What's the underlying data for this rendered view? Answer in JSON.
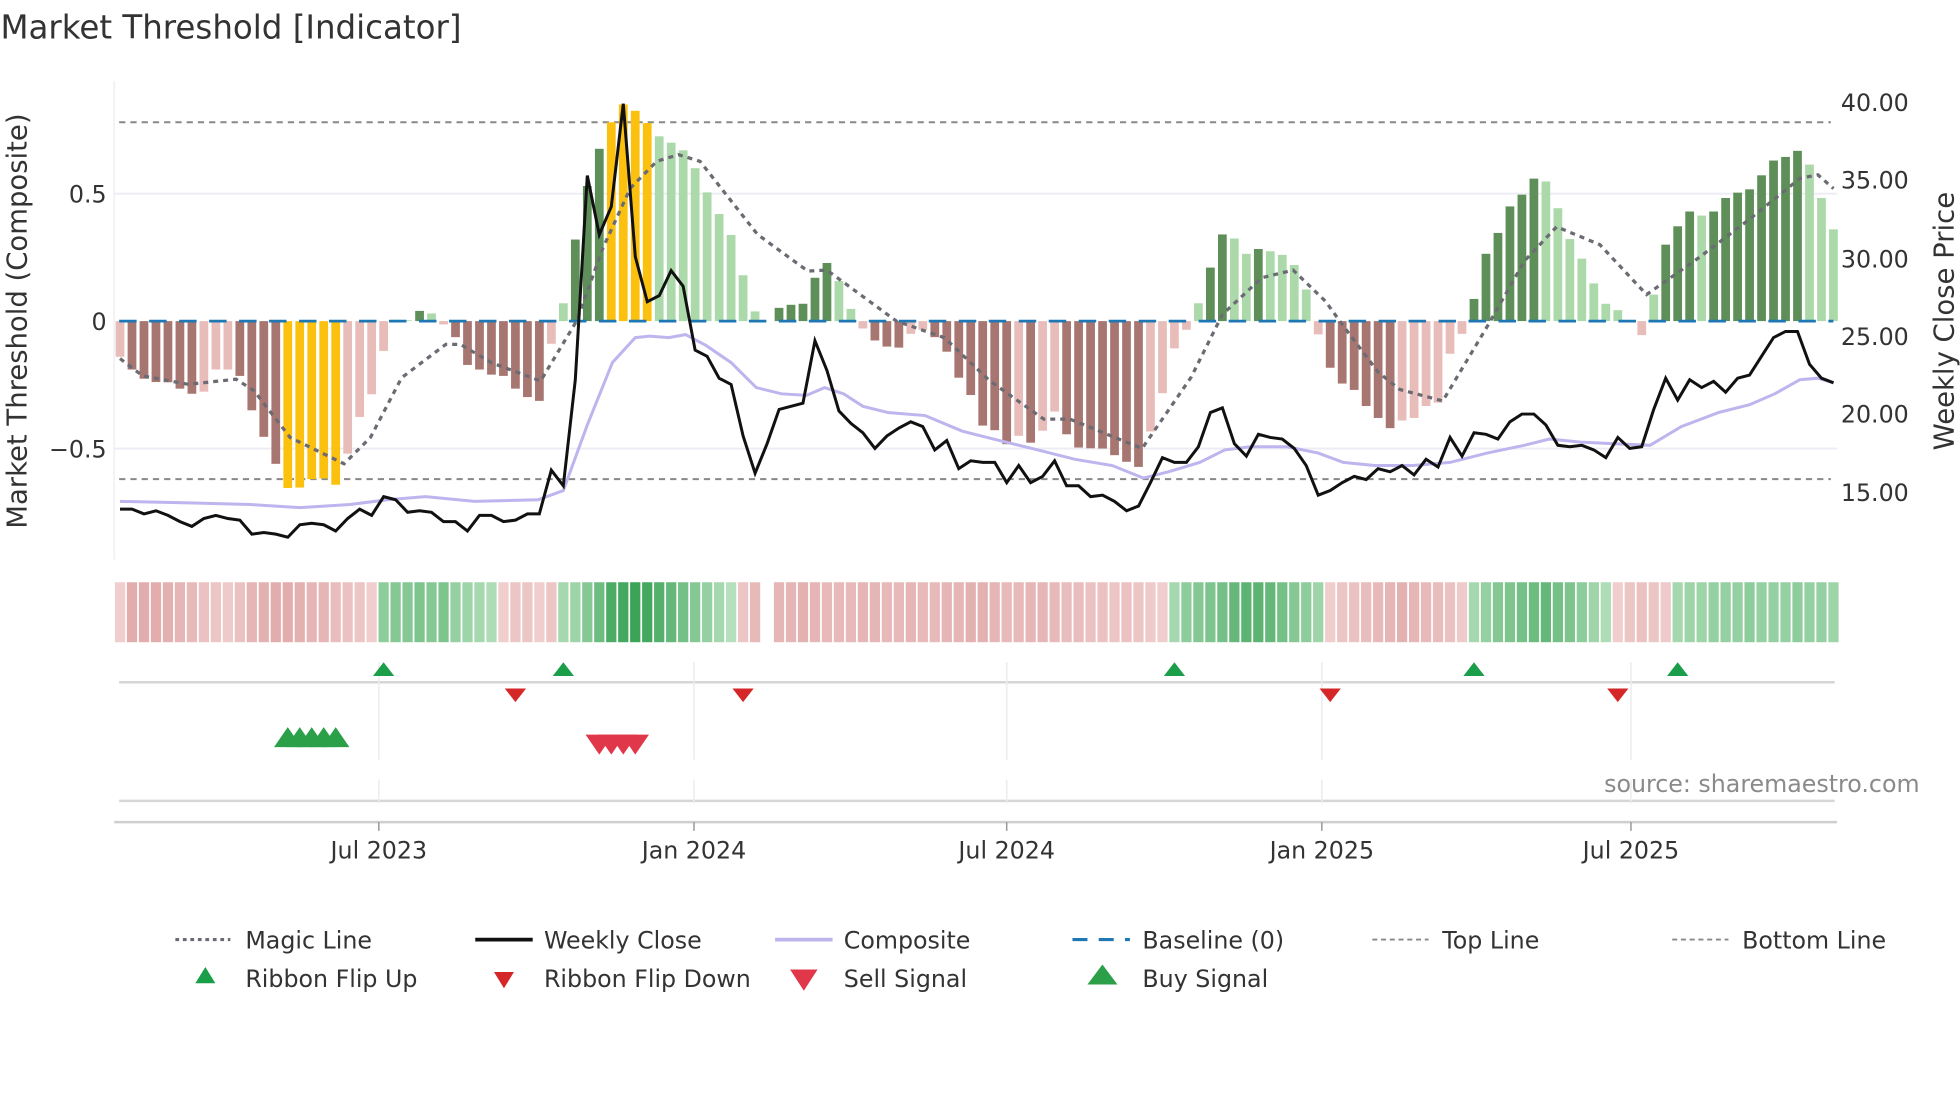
{
  "chart_data": {
    "type": "bar",
    "title": "Market Threshold [Indicator]",
    "ylabel_left": "Market Threshold (Composite)",
    "ylabel_right": "Weekly Close Price",
    "ylim_left": [
      -0.94,
      0.94
    ],
    "ylim_right": [
      10.7,
      41.4
    ],
    "grid": true,
    "legend_placement": "bottom",
    "source": "source: sharemaestro.com",
    "y_ticks_left": [
      {
        "value": 0.5,
        "label": "0.5"
      },
      {
        "value": 0,
        "label": "0"
      },
      {
        "value": -0.5,
        "label": "−0.5"
      }
    ],
    "y_ticks_right": [
      {
        "value": 40,
        "label": "40.00"
      },
      {
        "value": 35,
        "label": "35.00"
      },
      {
        "value": 30,
        "label": "30.00"
      },
      {
        "value": 25,
        "label": "25.00"
      },
      {
        "value": 20,
        "label": "20.00"
      },
      {
        "value": 15,
        "label": "15.00"
      }
    ],
    "x_ticks": [
      {
        "week": 21.6,
        "label": "Jul 2023"
      },
      {
        "week": 47.9,
        "label": "Jan 2024"
      },
      {
        "week": 74,
        "label": "Jul 2024"
      },
      {
        "week": 100.3,
        "label": "Jan 2025"
      },
      {
        "week": 126.1,
        "label": "Jul 2025"
      }
    ],
    "top_line": 0.78,
    "bottom_line": -0.62,
    "baseline": 0,
    "composite_values": [
      -0.14,
      -0.19,
      -0.226,
      -0.239,
      -0.24,
      -0.265,
      -0.285,
      -0.277,
      -0.19,
      -0.19,
      -0.215,
      -0.35,
      -0.454,
      -0.56,
      -0.655,
      -0.653,
      -0.62,
      -0.617,
      -0.642,
      -0.52,
      -0.376,
      -0.287,
      -0.117,
      0.005,
      0.003,
      0.04,
      0.03,
      -0.013,
      -0.063,
      -0.172,
      -0.19,
      -0.21,
      -0.215,
      -0.265,
      -0.298,
      -0.313,
      -0.089,
      0.07,
      0.32,
      0.53,
      0.676,
      0.78,
      0.85,
      0.825,
      0.777,
      0.725,
      0.7,
      0.67,
      0.6,
      0.505,
      0.42,
      0.338,
      0.18,
      0.038,
      null,
      0.052,
      0.064,
      0.068,
      0.17,
      0.228,
      0.157,
      0.048,
      -0.029,
      -0.076,
      -0.1,
      -0.104,
      -0.05,
      -0.034,
      -0.063,
      -0.12,
      -0.222,
      -0.29,
      -0.41,
      -0.428,
      -0.483,
      -0.45,
      -0.477,
      -0.43,
      -0.355,
      -0.444,
      -0.496,
      -0.499,
      -0.5,
      -0.526,
      -0.552,
      -0.572,
      -0.433,
      -0.283,
      -0.107,
      -0.034,
      0.07,
      0.21,
      0.34,
      0.324,
      0.264,
      0.283,
      0.274,
      0.26,
      0.22,
      0.124,
      -0.052,
      -0.183,
      -0.245,
      -0.27,
      -0.333,
      -0.38,
      -0.42,
      -0.39,
      -0.38,
      -0.333,
      -0.32,
      -0.128,
      -0.05,
      0.087,
      0.264,
      0.346,
      0.45,
      0.496,
      0.559,
      0.548,
      0.443,
      0.322,
      0.245,
      0.148,
      0.068,
      0.043,
      0,
      -0.055,
      0.104,
      0.3,
      0.372,
      0.43,
      0.414,
      0.43,
      0.483,
      0.504,
      0.517,
      0.572,
      0.63,
      0.644,
      0.668,
      0.614,
      0.483,
      0.36
    ],
    "bar_strength": [
      1,
      2,
      2,
      2,
      2,
      2,
      2,
      1,
      1,
      1,
      2,
      2,
      2,
      2,
      3,
      3,
      3,
      3,
      3,
      1,
      1,
      1,
      1,
      1,
      1,
      2,
      1,
      1,
      2,
      2,
      2,
      2,
      2,
      2,
      2,
      2,
      1,
      1,
      2,
      2,
      2,
      3,
      3,
      3,
      3,
      1,
      1,
      1,
      1,
      1,
      1,
      1,
      1,
      1,
      0,
      2,
      2,
      2,
      2,
      2,
      1,
      1,
      1,
      2,
      2,
      2,
      1,
      1,
      2,
      2,
      2,
      2,
      2,
      2,
      2,
      1,
      2,
      1,
      1,
      2,
      2,
      2,
      2,
      2,
      2,
      2,
      1,
      1,
      1,
      1,
      1,
      2,
      2,
      1,
      1,
      2,
      1,
      1,
      1,
      1,
      1,
      2,
      2,
      2,
      2,
      2,
      2,
      1,
      1,
      1,
      1,
      1,
      1,
      2,
      2,
      2,
      2,
      2,
      2,
      1,
      1,
      1,
      1,
      1,
      1,
      1,
      0,
      1,
      1,
      2,
      2,
      2,
      1,
      2,
      2,
      2,
      2,
      2,
      2,
      2,
      2,
      1,
      1,
      1
    ],
    "weekly_close": [
      13.9,
      13.9,
      13.6,
      13.8,
      13.5,
      13.1,
      12.8,
      13.3,
      13.5,
      13.3,
      13.2,
      12.3,
      12.4,
      12.3,
      12.1,
      12.9,
      13.0,
      12.9,
      12.5,
      13.3,
      13.9,
      13.5,
      14.7,
      14.5,
      13.7,
      13.8,
      13.7,
      13.1,
      13.1,
      12.5,
      13.5,
      13.5,
      13.1,
      13.2,
      13.6,
      13.6,
      16.4,
      15.4,
      22.2,
      35.3,
      31.5,
      33.3,
      39.9,
      30.1,
      27.2,
      27.6,
      29.2,
      28.2,
      24.1,
      23.7,
      22.3,
      21.9,
      18.6,
      16.2,
      18.1,
      20.3,
      20.5,
      20.7,
      24.7,
      22.8,
      20.2,
      19.4,
      18.8,
      17.8,
      18.6,
      19.1,
      19.5,
      19.2,
      17.7,
      18.3,
      16.5,
      17.0,
      16.9,
      16.9,
      15.6,
      16.7,
      15.6,
      16.0,
      17.0,
      15.4,
      15.4,
      14.7,
      14.8,
      14.4,
      13.8,
      14.1,
      15.6,
      17.2,
      16.9,
      16.9,
      17.9,
      20.1,
      20.4,
      18.1,
      17.3,
      18.7,
      18.5,
      18.4,
      17.8,
      16.7,
      14.8,
      15.1,
      15.6,
      16.0,
      15.8,
      16.5,
      16.3,
      16.7,
      16.1,
      17.1,
      16.6,
      18.5,
      17.3,
      18.8,
      18.7,
      18.4,
      19.5,
      20.0,
      20.0,
      19.3,
      18.0,
      17.9,
      18.0,
      17.7,
      17.2,
      18.5,
      17.8,
      17.9,
      20.3,
      22.3,
      20.9,
      22.2,
      21.7,
      22.1,
      21.4,
      22.3,
      22.5,
      23.7,
      24.9,
      25.3,
      25.3,
      23.2,
      22.3,
      22.0
    ],
    "magic_line": [
      [
        0,
        -0.147
      ],
      [
        1.9,
        -0.215
      ],
      [
        5.7,
        -0.248
      ],
      [
        9.7,
        -0.228
      ],
      [
        11.2,
        -0.274
      ],
      [
        14.2,
        -0.457
      ],
      [
        18.7,
        -0.56
      ],
      [
        20.9,
        -0.457
      ],
      [
        23.5,
        -0.222
      ],
      [
        27.2,
        -0.091
      ],
      [
        28.4,
        -0.091
      ],
      [
        31,
        -0.163
      ],
      [
        35.1,
        -0.235
      ],
      [
        38.1,
        0
      ],
      [
        40.3,
        0.287
      ],
      [
        42.6,
        0.522
      ],
      [
        44.8,
        0.627
      ],
      [
        46.6,
        0.653
      ],
      [
        48.4,
        0.627
      ],
      [
        53.2,
        0.34
      ],
      [
        57.4,
        0.196
      ],
      [
        59,
        0.2
      ],
      [
        64.8,
        0
      ],
      [
        68.8,
        -0.065
      ],
      [
        72.6,
        -0.235
      ],
      [
        77.1,
        -0.385
      ],
      [
        79.3,
        -0.385
      ],
      [
        85.3,
        -0.5
      ],
      [
        89.4,
        -0.22
      ],
      [
        92,
        0.026
      ],
      [
        95.3,
        0.17
      ],
      [
        97.9,
        0.2
      ],
      [
        100.6,
        0.078
      ],
      [
        102,
        -0.013
      ],
      [
        105,
        -0.2
      ],
      [
        106.8,
        -0.268
      ],
      [
        110.4,
        -0.313
      ],
      [
        114.2,
        -0.013
      ],
      [
        117.2,
        0.235
      ],
      [
        119.9,
        0.37
      ],
      [
        123.5,
        0.3
      ],
      [
        127.4,
        0.104
      ],
      [
        131.8,
        0.25
      ],
      [
        136,
        0.4
      ],
      [
        140.2,
        0.56
      ],
      [
        141.7,
        0.574
      ],
      [
        143,
        0.52
      ]
    ],
    "composite_price_line": [
      [
        0,
        14.4
      ],
      [
        5.7,
        14.3
      ],
      [
        10.9,
        14.2
      ],
      [
        15,
        14.0
      ],
      [
        19.2,
        14.2
      ],
      [
        22.3,
        14.5
      ],
      [
        25.5,
        14.7
      ],
      [
        29.6,
        14.4
      ],
      [
        34.9,
        14.5
      ],
      [
        37,
        15.1
      ],
      [
        39,
        19.3
      ],
      [
        41.1,
        23.3
      ],
      [
        43,
        24.9
      ],
      [
        44.2,
        25.0
      ],
      [
        45.8,
        24.9
      ],
      [
        47.2,
        25.1
      ],
      [
        48.9,
        24.4
      ],
      [
        51,
        23.3
      ],
      [
        53.1,
        21.7
      ],
      [
        55.2,
        21.3
      ],
      [
        57.3,
        21.2
      ],
      [
        58.8,
        21.7
      ],
      [
        60.4,
        21.3
      ],
      [
        62,
        20.5
      ],
      [
        64.1,
        20.1
      ],
      [
        67.2,
        19.9
      ],
      [
        70.3,
        18.9
      ],
      [
        73.4,
        18.3
      ],
      [
        76.6,
        17.7
      ],
      [
        79.7,
        17.1
      ],
      [
        82.8,
        16.7
      ],
      [
        85.4,
        15.9
      ],
      [
        87.5,
        16.3
      ],
      [
        90.1,
        16.9
      ],
      [
        92.2,
        17.7
      ],
      [
        94.3,
        17.9
      ],
      [
        97.4,
        17.9
      ],
      [
        100,
        17.5
      ],
      [
        102.1,
        16.9
      ],
      [
        104.7,
        16.7
      ],
      [
        107.9,
        16.7
      ],
      [
        111,
        16.9
      ],
      [
        114.1,
        17.5
      ],
      [
        117.2,
        18.0
      ],
      [
        119.3,
        18.4
      ],
      [
        121.9,
        18.2
      ],
      [
        124.5,
        18.1
      ],
      [
        127.7,
        18.0
      ],
      [
        130.3,
        19.2
      ],
      [
        133.4,
        20.1
      ],
      [
        136,
        20.6
      ],
      [
        138.1,
        21.3
      ],
      [
        140.2,
        22.2
      ],
      [
        141.7,
        22.3
      ],
      [
        143,
        22.0
      ]
    ],
    "ribbon": [
      -0.2,
      -0.6,
      -0.6,
      -0.6,
      -0.55,
      -0.5,
      -0.45,
      -0.35,
      -0.3,
      -0.25,
      -0.35,
      -0.5,
      -0.55,
      -0.6,
      -0.6,
      -0.55,
      -0.5,
      -0.5,
      -0.4,
      -0.35,
      -0.3,
      -0.2,
      0.45,
      0.5,
      0.5,
      0.55,
      0.5,
      0.55,
      0.4,
      0.35,
      0.3,
      0.25,
      -0.2,
      -0.3,
      -0.3,
      -0.2,
      -0.3,
      0.3,
      0.35,
      0.5,
      0.65,
      0.85,
      0.9,
      0.95,
      0.9,
      0.8,
      0.7,
      0.6,
      0.5,
      0.4,
      0.3,
      0.2,
      -0.3,
      -0.45,
      null,
      -0.5,
      -0.5,
      -0.55,
      -0.5,
      -0.45,
      -0.45,
      -0.45,
      -0.5,
      -0.5,
      -0.45,
      -0.45,
      -0.5,
      -0.45,
      -0.45,
      -0.5,
      -0.5,
      -0.55,
      -0.55,
      -0.5,
      -0.45,
      -0.45,
      -0.5,
      -0.5,
      -0.45,
      -0.4,
      -0.4,
      -0.35,
      -0.35,
      -0.3,
      -0.35,
      -0.3,
      -0.25,
      -0.2,
      0.3,
      0.45,
      0.5,
      0.55,
      0.6,
      0.7,
      0.75,
      0.75,
      0.7,
      0.6,
      0.5,
      0.45,
      0.35,
      -0.2,
      -0.3,
      -0.35,
      -0.4,
      -0.45,
      -0.5,
      -0.55,
      -0.5,
      -0.45,
      -0.4,
      -0.35,
      -0.25,
      0.3,
      0.4,
      0.5,
      0.55,
      0.6,
      0.65,
      0.7,
      0.6,
      0.55,
      0.45,
      0.35,
      0.25,
      -0.2,
      -0.3,
      -0.35,
      -0.3,
      -0.25,
      0.3,
      0.35,
      0.35,
      0.4,
      0.4,
      0.4,
      0.45,
      0.4,
      0.4,
      0.4,
      0.45,
      0.4,
      0.4,
      0.35
    ],
    "ribbon_flip_up_weeks": [
      22,
      37,
      88,
      113,
      130
    ],
    "ribbon_flip_down_weeks": [
      33,
      52,
      101,
      125
    ],
    "buy_signal_weeks": [
      14,
      15,
      16,
      17,
      18
    ],
    "sell_signal_weeks": [
      40,
      41,
      42,
      43
    ],
    "colors": {
      "bar_down_strong": "#a87671",
      "bar_down_weak": "#e8bdb9",
      "bar_up_strong": "#5e8f59",
      "bar_up_weak": "#acd9a9",
      "bar_extreme": "#fcc10f",
      "magic": "#6b6b73",
      "close": "#111111",
      "composite": "#bdb5ee",
      "baseline": "#1f77b4",
      "threshold": "#888888",
      "flip_up": "#1a9e4a",
      "flip_down": "#d62728",
      "sell": "#e0384a",
      "buy": "#2ca048"
    },
    "legend": [
      {
        "label": "Magic Line"
      },
      {
        "label": "Weekly Close"
      },
      {
        "label": "Composite"
      },
      {
        "label": "Baseline (0)"
      },
      {
        "label": "Top Line"
      },
      {
        "label": "Bottom Line"
      },
      {
        "label": "Ribbon Flip Up"
      },
      {
        "label": "Ribbon Flip Down"
      },
      {
        "label": "Sell Signal"
      },
      {
        "label": "Buy Signal"
      }
    ]
  }
}
